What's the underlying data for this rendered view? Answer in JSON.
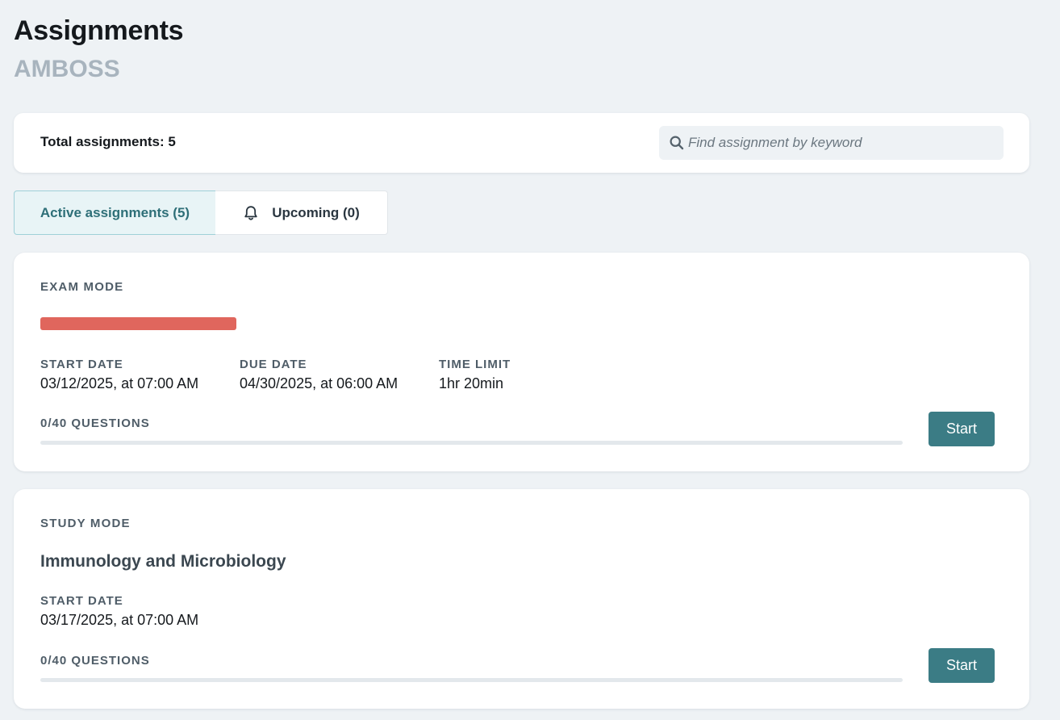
{
  "header": {
    "title": "Assignments",
    "subtitle": "AMBOSS"
  },
  "summary": {
    "total_label": "Total assignments: 5",
    "search_placeholder": "Find assignment by keyword",
    "search_value": ""
  },
  "tabs": [
    {
      "label": "Active assignments (5)",
      "active": true
    },
    {
      "label": "Upcoming (0)",
      "icon": "bell-icon",
      "active": false
    }
  ],
  "assignments": [
    {
      "mode": "EXAM MODE",
      "title": "",
      "title_redacted": true,
      "meta": [
        {
          "label": "START DATE",
          "value": "03/12/2025, at 07:00 AM"
        },
        {
          "label": "DUE DATE",
          "value": "04/30/2025, at 06:00 AM"
        },
        {
          "label": "TIME LIMIT",
          "value": "1hr 20min"
        }
      ],
      "questions_label": "0/40 QUESTIONS",
      "progress": 0,
      "button_label": "Start"
    },
    {
      "mode": "STUDY MODE",
      "title": "Immunology and Microbiology",
      "title_redacted": false,
      "meta": [
        {
          "label": "START DATE",
          "value": "03/17/2025, at 07:00 AM"
        }
      ],
      "questions_label": "0/40 QUESTIONS",
      "progress": 0,
      "button_label": "Start"
    }
  ],
  "colors": {
    "accent": "#3b7c85",
    "redaction": "#e0665d"
  }
}
